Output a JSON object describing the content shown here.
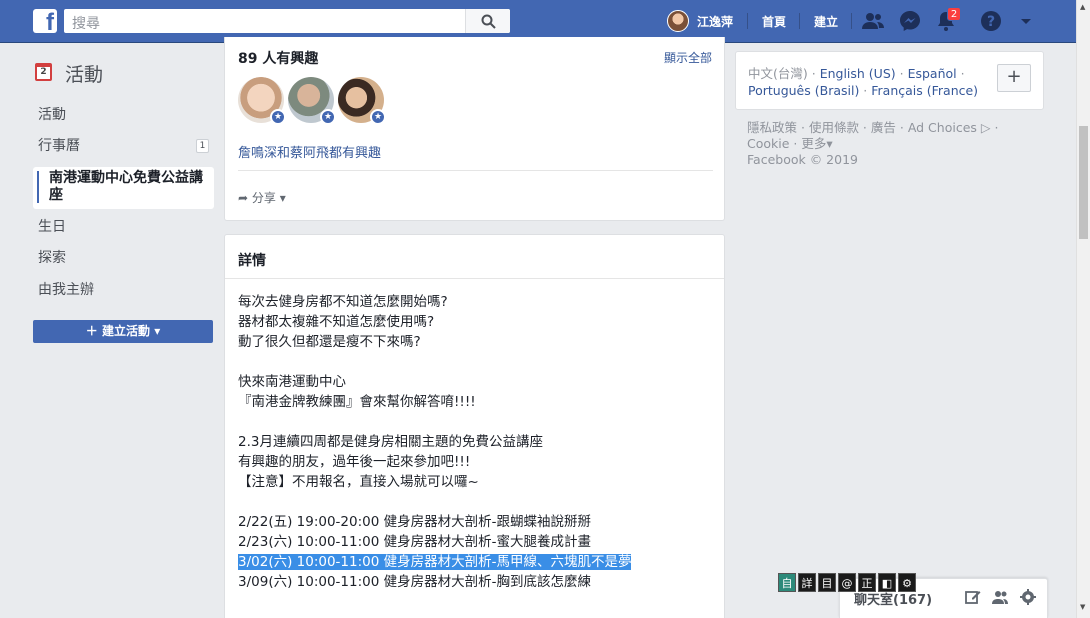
{
  "topbar": {
    "logo": "f",
    "search_placeholder": "搜尋",
    "user_name": "江逸萍",
    "home": "首頁",
    "create": "建立",
    "notification_count": "2"
  },
  "sidebar": {
    "section_title": "活動",
    "calendar_day": "2",
    "items": [
      {
        "label": "活動"
      },
      {
        "label": "行事曆",
        "count": "1"
      },
      {
        "label": "南港運動中心免費公益講座"
      },
      {
        "label": "生日"
      },
      {
        "label": "探索"
      },
      {
        "label": "由我主辦"
      }
    ],
    "create_button": "建立活動"
  },
  "interest": {
    "title": "89 人有興趣",
    "show_all": "顯示全部",
    "friends_text": "詹鳴深和蔡阿飛都有興趣",
    "share": "分享"
  },
  "details": {
    "title": "詳情",
    "lines": [
      "每次去健身房都不知道怎麼開始嗎?",
      "器材都太複雜不知道怎麼使用嗎?",
      "動了很久但都還是瘦不下來嗎?",
      "",
      "快來南港運動中心",
      "『南港金牌教練團』會來幫你解答唷!!!!",
      "",
      "2.3月連續四周都是健身房相關主題的免費公益講座",
      "有興趣的朋友，過年後一起來參加吧!!!",
      "【注意】不用報名，直接入場就可以囉~",
      "",
      "2/22(五) 19:00-20:00 健身房器材大剖析-跟蝴蝶袖說掰掰",
      "2/23(六) 10:00-11:00 健身房器材大剖析-蜜大腿養成計畫",
      "3/02(六) 10:00-11:00 健身房器材大剖析-馬甲線、六塊肌不是夢",
      "3/09(六) 10:00-11:00 健身房器材大剖析-胸到底該怎麼練"
    ]
  },
  "languages": {
    "current": "中文(台灣)",
    "options": [
      "English (US)",
      "Español",
      "Português (Brasil)",
      "Français (France)"
    ]
  },
  "footer": {
    "links": [
      "隱私政策",
      "使用條款",
      "廣告",
      "Ad Choices",
      "Cookie",
      "更多"
    ],
    "copyright": "Facebook © 2019"
  },
  "chat": {
    "label": "聊天室(167)"
  },
  "ime": [
    "自",
    "詳",
    "目",
    "@",
    "正",
    "◧",
    "⚙"
  ],
  "colors": {
    "brand": "#4267b2",
    "link": "#365899",
    "highlight": "#3a8ee6"
  }
}
